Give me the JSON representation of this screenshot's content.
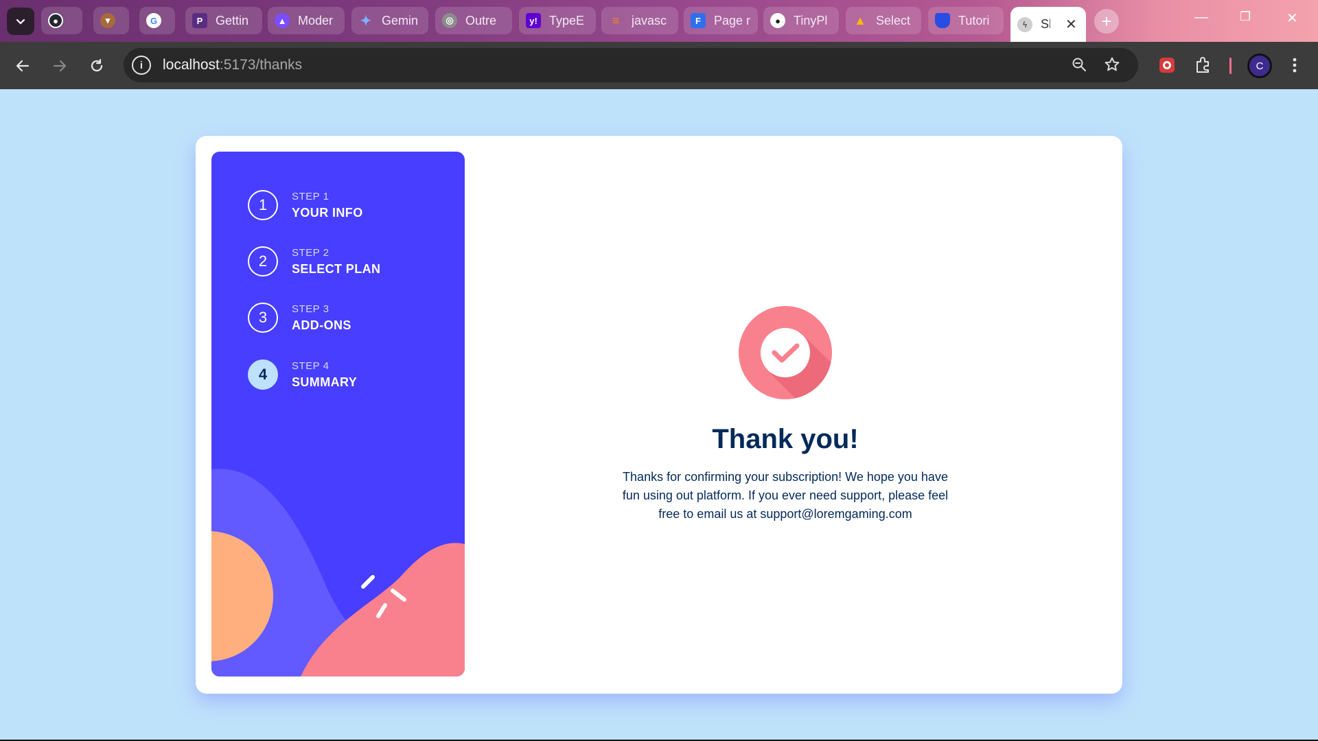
{
  "browser": {
    "tabs": [
      {
        "title": "",
        "icon": "github-icon",
        "color": "#24292f"
      },
      {
        "title": "",
        "icon": "fox-icon",
        "color": "#a86a3c"
      },
      {
        "title": "",
        "icon": "google-icon",
        "color": "#ffffff"
      },
      {
        "title": "Gettin",
        "icon": "p-icon",
        "color": "#5a2d82"
      },
      {
        "title": "Moder",
        "icon": "rocket-icon",
        "color": "#7c4dff"
      },
      {
        "title": "Gemin",
        "icon": "gemini-icon",
        "color": "#4f8df5"
      },
      {
        "title": "Outre",
        "icon": "globe-icon",
        "color": "#8c8c8c"
      },
      {
        "title": "TypeE",
        "icon": "yahoo-icon",
        "color": "#6001d2"
      },
      {
        "title": "javasc",
        "icon": "stackoverflow-icon",
        "color": "#f48024"
      },
      {
        "title": "Page r",
        "icon": "f-icon",
        "color": "#2f6fed"
      },
      {
        "title": "TinyPl",
        "icon": "panda-icon",
        "color": "#222222"
      },
      {
        "title": "Select",
        "icon": "drive-icon",
        "color": "#34a853"
      },
      {
        "title": "Tutori",
        "icon": "css-icon",
        "color": "#264de4"
      },
      {
        "title": "Sl",
        "icon": "vite-icon",
        "color": "#cfcfcf",
        "active": true
      }
    ],
    "url_host": "localhost",
    "url_path": ":5173/thanks",
    "profile_initial": "C"
  },
  "sidebar": {
    "steps": [
      {
        "number": "1",
        "label": "STEP 1",
        "name": "YOUR INFO",
        "active": false
      },
      {
        "number": "2",
        "label": "STEP 2",
        "name": "SELECT PLAN",
        "active": false
      },
      {
        "number": "3",
        "label": "STEP 3",
        "name": "ADD-ONS",
        "active": false
      },
      {
        "number": "4",
        "label": "STEP 4",
        "name": "SUMMARY",
        "active": true
      }
    ]
  },
  "thanks": {
    "title": "Thank you!",
    "message": "Thanks for confirming your subscription! We hope you have fun using out platform. If you ever need support, please feel free to email us at support@loremgaming.com"
  },
  "colors": {
    "page_background": "#bfe2fb",
    "sidebar_background": "#483eff",
    "active_step": "#bee2fd",
    "heading": "#02295a",
    "checkmark_badge": "#f9818e"
  }
}
